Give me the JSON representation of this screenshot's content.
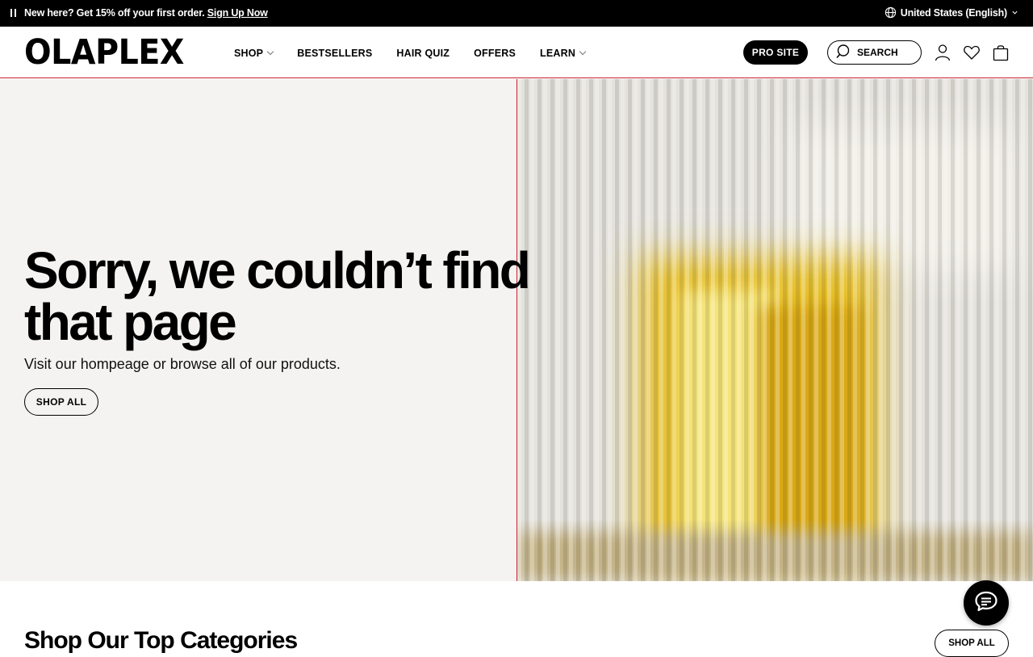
{
  "announcement": {
    "promo_text": "New here? Get 15% off your first order.",
    "promo_link": "Sign Up Now",
    "locale": "United States (English)"
  },
  "header": {
    "logo": "OLAPLEX",
    "nav": [
      {
        "label": "SHOP",
        "has_dropdown": true
      },
      {
        "label": "BESTSELLERS",
        "has_dropdown": false
      },
      {
        "label": "HAIR QUIZ",
        "has_dropdown": false
      },
      {
        "label": "OFFERS",
        "has_dropdown": false
      },
      {
        "label": "LEARN",
        "has_dropdown": true
      }
    ],
    "pro_site": "PRO SITE",
    "search": "SEARCH",
    "icons": [
      "account-icon",
      "wishlist-heart-icon",
      "cart-bag-icon"
    ]
  },
  "hero": {
    "title_line1": "Sorry, we couldn’t find",
    "title_line2": "that page",
    "subtitle": "Visit our hompeage or browse all of our products.",
    "cta": "SHOP ALL",
    "image_description_icon": "blurred-product-bottle-image"
  },
  "categories": {
    "title": "Shop Our Top Categories",
    "cta": "SHOP ALL"
  },
  "colors": {
    "announcement_bg": "#000000",
    "hero_left_bg": "#f4f3f1",
    "divider_accent": "#c9202f",
    "image_yellow": "#e8c12a"
  }
}
